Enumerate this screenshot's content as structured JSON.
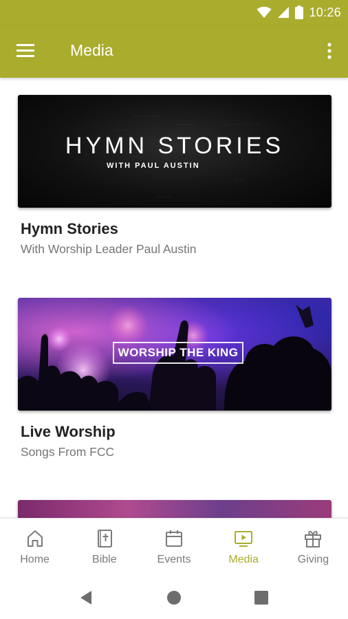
{
  "status_bar": {
    "time": "10:26",
    "icons": [
      "wifi-icon",
      "signal-icon",
      "battery-icon"
    ],
    "background": "#a9ac2d"
  },
  "app_bar": {
    "title": "Media",
    "menu_icon": "hamburger-menu-icon",
    "more_icon": "more-vertical-icon",
    "background": "#a9ac2d"
  },
  "cards": [
    {
      "title": "Hymn Stories",
      "subtitle": "With Worship Leader Paul Austin",
      "thumbnail": {
        "heading": "HYMN STORIES",
        "subheading": "WITH PAUL AUSTIN"
      }
    },
    {
      "title": "Live Worship",
      "subtitle": "Songs From FCC",
      "thumbnail": {
        "heading": "WORSHIP THE KING"
      }
    },
    {
      "title": "",
      "subtitle": ""
    }
  ],
  "bottom_nav": {
    "items": [
      {
        "label": "Home",
        "icon": "home-icon",
        "active": false
      },
      {
        "label": "Bible",
        "icon": "bible-icon",
        "active": false
      },
      {
        "label": "Events",
        "icon": "calendar-icon",
        "active": false
      },
      {
        "label": "Media",
        "icon": "media-play-icon",
        "active": true
      },
      {
        "label": "Giving",
        "icon": "gift-icon",
        "active": false
      }
    ],
    "active_color": "#a9ac2d",
    "inactive_color": "#7a7a7a"
  },
  "system_nav": {
    "buttons": [
      "back-icon",
      "home-circle-icon",
      "recents-icon"
    ]
  }
}
